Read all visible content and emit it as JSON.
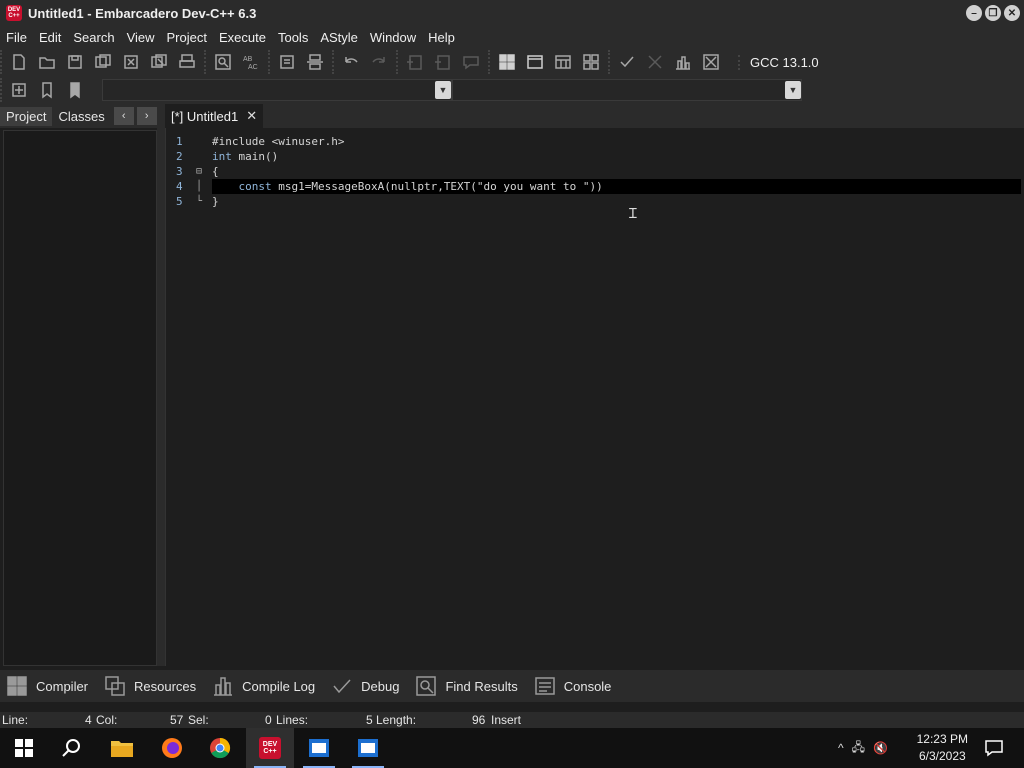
{
  "window": {
    "title": "Untitled1 - Embarcadero Dev-C++ 6.3",
    "icon_text": "DEV C++",
    "controls": [
      "minimize",
      "restore",
      "close"
    ]
  },
  "menu": [
    "File",
    "Edit",
    "Search",
    "View",
    "Project",
    "Execute",
    "Tools",
    "AStyle",
    "Window",
    "Help"
  ],
  "toolbar": {
    "compiler": "GCC 13.1.0"
  },
  "left_panel": {
    "tabs": [
      "Project",
      "Classes"
    ],
    "active_tab": "Project",
    "prev": "‹",
    "next": "›"
  },
  "editor": {
    "tab_label": "[*] Untitled1",
    "tab_close": "✕",
    "lines": [
      {
        "num": "1",
        "text": "#include <winuser.h>"
      },
      {
        "num": "2",
        "text": "int main()"
      },
      {
        "num": "3",
        "text": "{"
      },
      {
        "num": "4",
        "text": "    const msg1=MessageBoxA(nullptr,TEXT(\"do you want to \"))"
      },
      {
        "num": "5",
        "text": "}"
      }
    ]
  },
  "bottom_tabs": [
    "Compiler",
    "Resources",
    "Compile Log",
    "Debug",
    "Find Results",
    "Console"
  ],
  "status": {
    "line_label": "Line:",
    "line_value": "4",
    "col_label": "Col:",
    "col_value": "57",
    "sel_label": "Sel:",
    "sel_value": "0",
    "lines_label": "Lines:",
    "lines_value": "5",
    "length_label": "Length:",
    "length_value": "96",
    "mode": "Insert"
  },
  "taskbar": {
    "time": "12:23 PM",
    "date": "6/3/2023"
  },
  "colors": {
    "background": "#1e1e1e",
    "chrome": "#2b2b2b",
    "line_numbers": "#8fb4d8",
    "keyword": "#8fb4d8"
  }
}
